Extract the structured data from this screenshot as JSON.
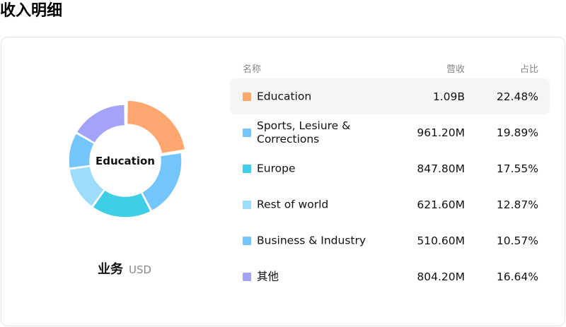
{
  "page": {
    "title": "收入明细"
  },
  "chart": {
    "center_label": "Education",
    "caption_name": "业务",
    "caption_unit": "USD"
  },
  "table": {
    "headers": {
      "name": "名称",
      "revenue": "营收",
      "percent": "占比"
    },
    "rows": [
      {
        "name": "Education",
        "revenue": "1.09B",
        "percent": "22.48%",
        "color": "#ffa76e"
      },
      {
        "name": "Sports, Lesiure & Corrections",
        "revenue": "961.20M",
        "percent": "19.89%",
        "color": "#74c5fb"
      },
      {
        "name": "Europe",
        "revenue": "847.80M",
        "percent": "17.55%",
        "color": "#3ecfe6"
      },
      {
        "name": "Rest of world",
        "revenue": "621.60M",
        "percent": "12.87%",
        "color": "#9edcfb"
      },
      {
        "name": "Business & Industry",
        "revenue": "510.60M",
        "percent": "10.57%",
        "color": "#74c5fb"
      },
      {
        "name": "其他",
        "revenue": "804.20M",
        "percent": "16.64%",
        "color": "#a3a3fa"
      }
    ]
  },
  "chart_data": {
    "type": "pie",
    "categories": [
      "Education",
      "Sports, Lesiure & Corrections",
      "Europe",
      "Rest of world",
      "Business & Industry",
      "其他"
    ],
    "values": [
      22.48,
      19.89,
      17.55,
      12.87,
      10.57,
      16.64
    ],
    "colors": [
      "#ffa76e",
      "#74c5fb",
      "#3ecfe6",
      "#9edcfb",
      "#74c5fb",
      "#a3a3fa"
    ],
    "highlighted": "Education"
  }
}
